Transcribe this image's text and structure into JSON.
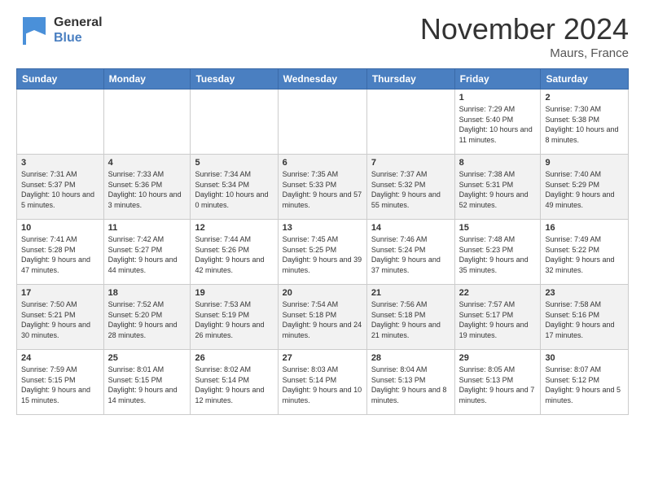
{
  "header": {
    "logo_general": "General",
    "logo_blue": "Blue",
    "month_title": "November 2024",
    "location": "Maurs, France"
  },
  "weekdays": [
    "Sunday",
    "Monday",
    "Tuesday",
    "Wednesday",
    "Thursday",
    "Friday",
    "Saturday"
  ],
  "weeks": [
    [
      {
        "day": "",
        "info": ""
      },
      {
        "day": "",
        "info": ""
      },
      {
        "day": "",
        "info": ""
      },
      {
        "day": "",
        "info": ""
      },
      {
        "day": "",
        "info": ""
      },
      {
        "day": "1",
        "info": "Sunrise: 7:29 AM\nSunset: 5:40 PM\nDaylight: 10 hours and 11 minutes."
      },
      {
        "day": "2",
        "info": "Sunrise: 7:30 AM\nSunset: 5:38 PM\nDaylight: 10 hours and 8 minutes."
      }
    ],
    [
      {
        "day": "3",
        "info": "Sunrise: 7:31 AM\nSunset: 5:37 PM\nDaylight: 10 hours and 5 minutes."
      },
      {
        "day": "4",
        "info": "Sunrise: 7:33 AM\nSunset: 5:36 PM\nDaylight: 10 hours and 3 minutes."
      },
      {
        "day": "5",
        "info": "Sunrise: 7:34 AM\nSunset: 5:34 PM\nDaylight: 10 hours and 0 minutes."
      },
      {
        "day": "6",
        "info": "Sunrise: 7:35 AM\nSunset: 5:33 PM\nDaylight: 9 hours and 57 minutes."
      },
      {
        "day": "7",
        "info": "Sunrise: 7:37 AM\nSunset: 5:32 PM\nDaylight: 9 hours and 55 minutes."
      },
      {
        "day": "8",
        "info": "Sunrise: 7:38 AM\nSunset: 5:31 PM\nDaylight: 9 hours and 52 minutes."
      },
      {
        "day": "9",
        "info": "Sunrise: 7:40 AM\nSunset: 5:29 PM\nDaylight: 9 hours and 49 minutes."
      }
    ],
    [
      {
        "day": "10",
        "info": "Sunrise: 7:41 AM\nSunset: 5:28 PM\nDaylight: 9 hours and 47 minutes."
      },
      {
        "day": "11",
        "info": "Sunrise: 7:42 AM\nSunset: 5:27 PM\nDaylight: 9 hours and 44 minutes."
      },
      {
        "day": "12",
        "info": "Sunrise: 7:44 AM\nSunset: 5:26 PM\nDaylight: 9 hours and 42 minutes."
      },
      {
        "day": "13",
        "info": "Sunrise: 7:45 AM\nSunset: 5:25 PM\nDaylight: 9 hours and 39 minutes."
      },
      {
        "day": "14",
        "info": "Sunrise: 7:46 AM\nSunset: 5:24 PM\nDaylight: 9 hours and 37 minutes."
      },
      {
        "day": "15",
        "info": "Sunrise: 7:48 AM\nSunset: 5:23 PM\nDaylight: 9 hours and 35 minutes."
      },
      {
        "day": "16",
        "info": "Sunrise: 7:49 AM\nSunset: 5:22 PM\nDaylight: 9 hours and 32 minutes."
      }
    ],
    [
      {
        "day": "17",
        "info": "Sunrise: 7:50 AM\nSunset: 5:21 PM\nDaylight: 9 hours and 30 minutes."
      },
      {
        "day": "18",
        "info": "Sunrise: 7:52 AM\nSunset: 5:20 PM\nDaylight: 9 hours and 28 minutes."
      },
      {
        "day": "19",
        "info": "Sunrise: 7:53 AM\nSunset: 5:19 PM\nDaylight: 9 hours and 26 minutes."
      },
      {
        "day": "20",
        "info": "Sunrise: 7:54 AM\nSunset: 5:18 PM\nDaylight: 9 hours and 24 minutes."
      },
      {
        "day": "21",
        "info": "Sunrise: 7:56 AM\nSunset: 5:18 PM\nDaylight: 9 hours and 21 minutes."
      },
      {
        "day": "22",
        "info": "Sunrise: 7:57 AM\nSunset: 5:17 PM\nDaylight: 9 hours and 19 minutes."
      },
      {
        "day": "23",
        "info": "Sunrise: 7:58 AM\nSunset: 5:16 PM\nDaylight: 9 hours and 17 minutes."
      }
    ],
    [
      {
        "day": "24",
        "info": "Sunrise: 7:59 AM\nSunset: 5:15 PM\nDaylight: 9 hours and 15 minutes."
      },
      {
        "day": "25",
        "info": "Sunrise: 8:01 AM\nSunset: 5:15 PM\nDaylight: 9 hours and 14 minutes."
      },
      {
        "day": "26",
        "info": "Sunrise: 8:02 AM\nSunset: 5:14 PM\nDaylight: 9 hours and 12 minutes."
      },
      {
        "day": "27",
        "info": "Sunrise: 8:03 AM\nSunset: 5:14 PM\nDaylight: 9 hours and 10 minutes."
      },
      {
        "day": "28",
        "info": "Sunrise: 8:04 AM\nSunset: 5:13 PM\nDaylight: 9 hours and 8 minutes."
      },
      {
        "day": "29",
        "info": "Sunrise: 8:05 AM\nSunset: 5:13 PM\nDaylight: 9 hours and 7 minutes."
      },
      {
        "day": "30",
        "info": "Sunrise: 8:07 AM\nSunset: 5:12 PM\nDaylight: 9 hours and 5 minutes."
      }
    ]
  ]
}
